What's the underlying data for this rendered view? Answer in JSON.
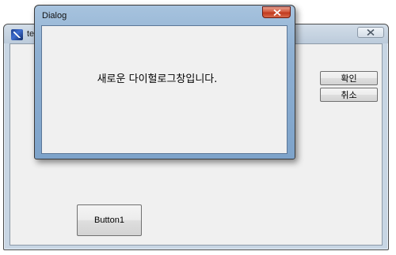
{
  "main_window": {
    "title": "tes",
    "client": {
      "button1_label": "Button1",
      "ok_label": "확인",
      "cancel_label": "취소"
    }
  },
  "dialog": {
    "title": "Dialog",
    "message": "새로운 다이헐로그창입니다."
  },
  "colors": {
    "dialog_close_red": "#c0391d",
    "client_gray": "#f0f0f0",
    "aero_frame_blue": "#8fb0d2"
  },
  "icons": {
    "main_window_app_icon": "app-icon",
    "main_window_close": "close-icon",
    "dialog_close": "close-icon"
  }
}
